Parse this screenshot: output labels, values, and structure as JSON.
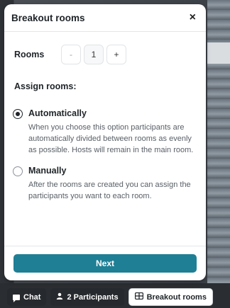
{
  "panel": {
    "title": "Breakout rooms",
    "close_glyph": "×"
  },
  "rooms": {
    "label": "Rooms",
    "minus": "-",
    "value": "1",
    "plus": "+"
  },
  "assign": {
    "heading": "Assign rooms:",
    "options": [
      {
        "title": "Automatically",
        "selected": true,
        "description": "When you choose this option participants are automatically divided between rooms as evenly as possible. Hosts will remain in the main room."
      },
      {
        "title": "Manually",
        "selected": false,
        "description": "After the rooms are created you can assign the participants you want to each room."
      }
    ]
  },
  "footer": {
    "next_label": "Next"
  },
  "bottombar": {
    "chat_label": "Chat",
    "participants_label": "2 Participants",
    "breakout_label": "Breakout rooms"
  },
  "colors": {
    "accent": "#1f7f95",
    "text": "#1f2428"
  },
  "icons": {
    "close": "close-icon",
    "chat": "chat-icon",
    "participants": "person-icon",
    "breakout": "breakout-rooms-icon"
  }
}
